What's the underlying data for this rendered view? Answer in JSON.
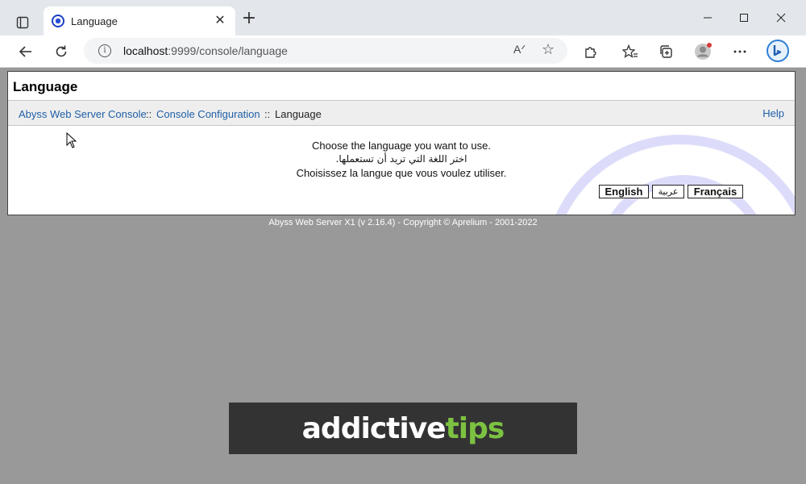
{
  "browser": {
    "tab_title": "Language",
    "address_host": "localhost",
    "address_path": ":9999/console/language",
    "read_aloud_label": "A",
    "icons": {
      "tabs": "tab-actions-icon",
      "favicon": "abyss-favicon-icon",
      "close_tab": "close-icon",
      "new_tab": "plus-icon",
      "minimize": "minimize-icon",
      "maximize": "maximize-icon",
      "close_window": "close-icon",
      "back": "back-arrow-icon",
      "refresh": "refresh-icon",
      "info": "info-icon",
      "extensions": "puzzle-icon",
      "favorites": "favorites-icon",
      "collections": "collections-icon",
      "profile": "profile-icon",
      "more": "more-icon",
      "bing": "bing-icon"
    }
  },
  "page": {
    "title": "Language",
    "breadcrumb": {
      "items": [
        "Abyss Web Server Console",
        "Console Configuration",
        "Language"
      ],
      "separator": "::"
    },
    "help_label": "Help",
    "messages": [
      "Choose the language you want to use.",
      "اختر اللغة التي تريد أن تستعملها.",
      "Choisissez la langue que vous voulez utiliser."
    ],
    "language_buttons": [
      "English",
      "عربية",
      "Français"
    ]
  },
  "footer": "Abyss Web Server X1 (v 2.16.4) - Copyright © Aprelium - 2001-2022",
  "watermark": {
    "part1": "addictive",
    "part2": "tips"
  },
  "colors": {
    "link": "#1f5fa8",
    "background": "#999999",
    "watermark_green": "#7cc242"
  }
}
